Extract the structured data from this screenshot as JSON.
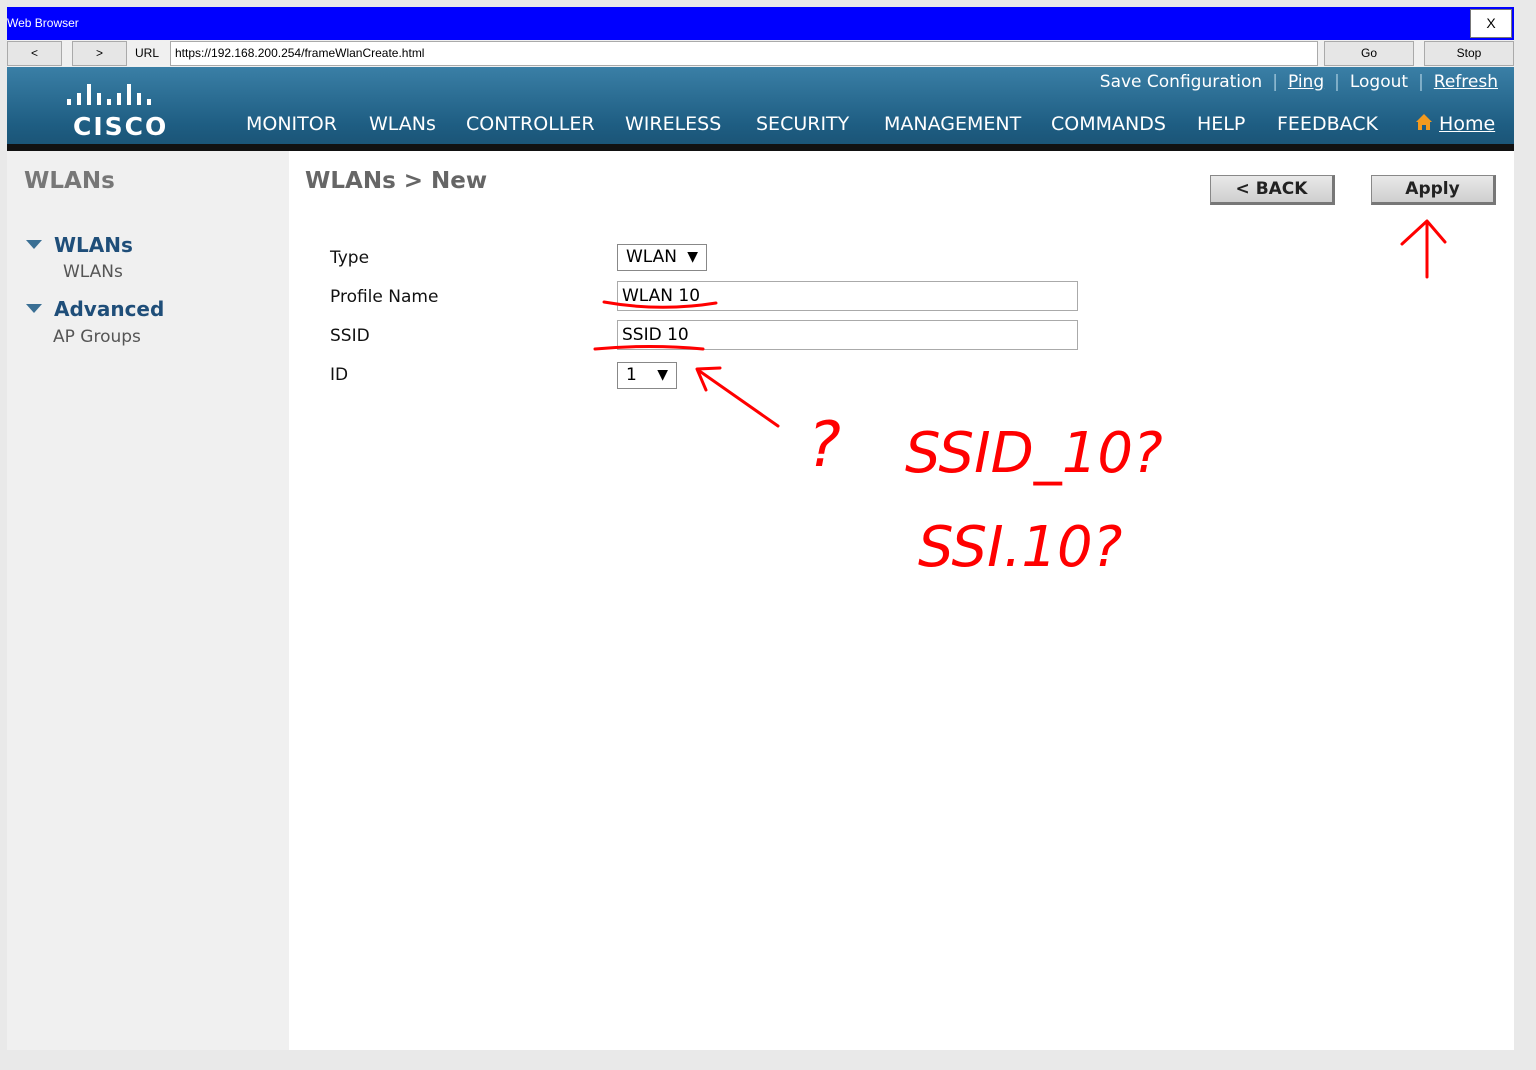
{
  "browser": {
    "title": "Web Browser",
    "close_label": "X",
    "back_label": "<",
    "forward_label": ">",
    "url_label": "URL",
    "url": "https://192.168.200.254/frameWlanCreate.html",
    "go_label": "Go",
    "stop_label": "Stop"
  },
  "header": {
    "logo_text": "cisco",
    "top_links": [
      "Save Configuration",
      "Ping",
      "Logout",
      "Refresh"
    ],
    "nav": [
      "MONITOR",
      "WLANs",
      "CONTROLLER",
      "WIRELESS",
      "SECURITY",
      "MANAGEMENT",
      "COMMANDS",
      "HELP",
      "FEEDBACK"
    ],
    "active_nav": "WLANs",
    "home_label": "Home"
  },
  "sidebar": {
    "title": "WLANs",
    "sections": [
      {
        "heading": "WLANs",
        "items": [
          "WLANs"
        ]
      },
      {
        "heading": "Advanced",
        "items": [
          "AP Groups"
        ]
      }
    ]
  },
  "main": {
    "title": "WLANs > New",
    "back_button": "< BACK",
    "apply_button": "Apply",
    "fields": {
      "type_label": "Type",
      "type_value": "WLAN",
      "profile_label": "Profile Name",
      "profile_value": "WLAN 10",
      "ssid_label": "SSID",
      "ssid_value": "SSID 10",
      "id_label": "ID",
      "id_value": "1"
    }
  },
  "annotations": {
    "color": "#ff0000",
    "question": "?",
    "guess1": "SSID_10?",
    "guess2": "SSI.10?"
  }
}
